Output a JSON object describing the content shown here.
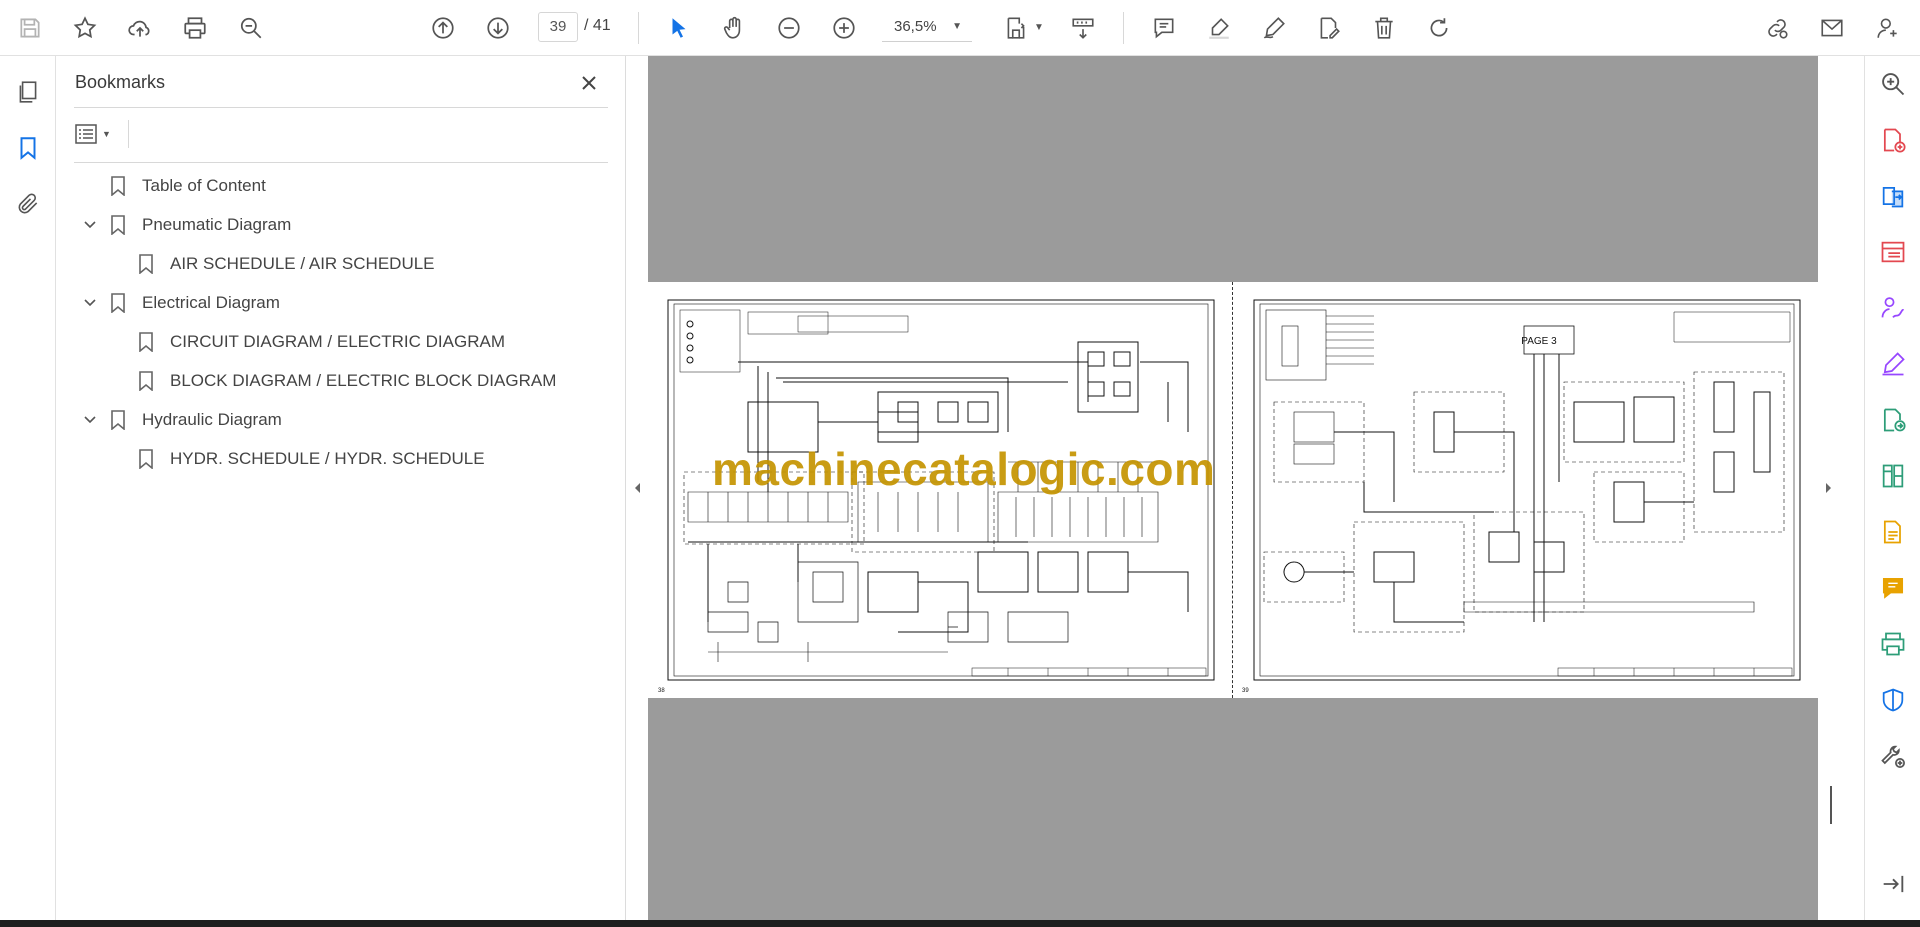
{
  "toolbar": {
    "page_current": "39",
    "page_total": "/ 41",
    "zoom": "36,5%"
  },
  "bookmarks": {
    "title": "Bookmarks",
    "items": [
      {
        "label": "Table of Content",
        "level": 0,
        "expandable": false
      },
      {
        "label": "Pneumatic Diagram",
        "level": 0,
        "expandable": true
      },
      {
        "label": "AIR SCHEDULE / AIR SCHEDULE",
        "level": 1,
        "expandable": false
      },
      {
        "label": "Electrical Diagram",
        "level": 0,
        "expandable": true
      },
      {
        "label": "CIRCUIT DIAGRAM / ELECTRIC DIAGRAM",
        "level": 1,
        "expandable": false
      },
      {
        "label": "BLOCK DIAGRAM / ELECTRIC BLOCK DIAGRAM",
        "level": 1,
        "expandable": false
      },
      {
        "label": "Hydraulic Diagram",
        "level": 0,
        "expandable": true
      },
      {
        "label": "HYDR. SCHEDULE / HYDR. SCHEDULE",
        "level": 1,
        "expandable": false
      }
    ]
  },
  "document": {
    "watermark": "machinecatalogic.com",
    "right_page_box": "PAGE 3",
    "left_page_number": "38",
    "right_page_number": "39"
  },
  "colors": {
    "accent_blue": "#1473e6",
    "tool_purple": "#9747ff",
    "tool_red": "#e34850",
    "tool_green": "#2d9d78",
    "tool_yellow": "#e8a200",
    "doc_bg": "#9b9b9b"
  }
}
